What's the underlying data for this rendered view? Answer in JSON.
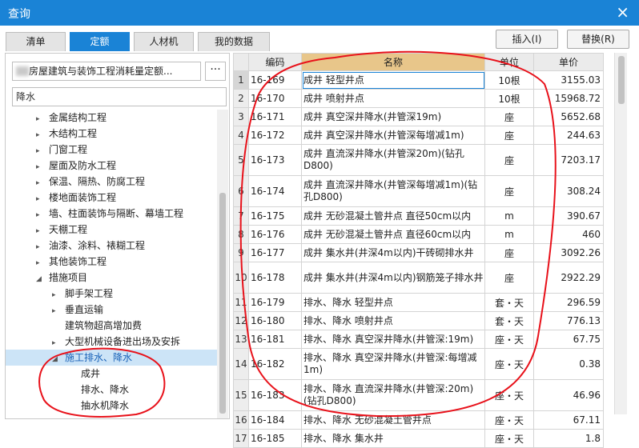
{
  "window": {
    "title": "查询",
    "close_icon": "×"
  },
  "tabs": [
    {
      "label": "清单",
      "active": false
    },
    {
      "label": "定额",
      "active": true
    },
    {
      "label": "人材机",
      "active": false
    },
    {
      "label": "我的数据",
      "active": false
    }
  ],
  "actions": {
    "insert_label": "插入(I)",
    "replace_label": "替换(R)"
  },
  "library": {
    "name": "房屋建筑与装饰工程消耗量定额...",
    "more_label": "···"
  },
  "search": {
    "value": "降水"
  },
  "tree": [
    {
      "label": "金属结构工程",
      "level": 0,
      "expander": "▸"
    },
    {
      "label": "木结构工程",
      "level": 0,
      "expander": "▸"
    },
    {
      "label": "门窗工程",
      "level": 0,
      "expander": "▸"
    },
    {
      "label": "屋面及防水工程",
      "level": 0,
      "expander": "▸"
    },
    {
      "label": "保温、隔热、防腐工程",
      "level": 0,
      "expander": "▸"
    },
    {
      "label": "楼地面装饰工程",
      "level": 0,
      "expander": "▸"
    },
    {
      "label": "墙、柱面装饰与隔断、幕墙工程",
      "level": 0,
      "expander": "▸"
    },
    {
      "label": "天棚工程",
      "level": 0,
      "expander": "▸"
    },
    {
      "label": "油漆、涂料、裱糊工程",
      "level": 0,
      "expander": "▸"
    },
    {
      "label": "其他装饰工程",
      "level": 0,
      "expander": "▸"
    },
    {
      "label": "措施项目",
      "level": 0,
      "expander": "◢"
    },
    {
      "label": "脚手架工程",
      "level": 1,
      "expander": "▸"
    },
    {
      "label": "垂直运输",
      "level": 1,
      "expander": "▸"
    },
    {
      "label": "建筑物超高增加费",
      "level": 1,
      "expander": ""
    },
    {
      "label": "大型机械设备进出场及安拆",
      "level": 1,
      "expander": "▸"
    },
    {
      "label": "施工排水、降水",
      "level": 1,
      "expander": "◢",
      "selected": true
    },
    {
      "label": "成井",
      "level": 2,
      "expander": ""
    },
    {
      "label": "排水、降水",
      "level": 2,
      "expander": ""
    },
    {
      "label": "抽水机降水",
      "level": 2,
      "expander": ""
    }
  ],
  "table": {
    "headers": {
      "code": "编码",
      "name": "名称",
      "unit": "单位",
      "price": "单价"
    },
    "rows": [
      {
        "n": "1",
        "code": "16-169",
        "name": "成井 轻型井点",
        "unit": "10根",
        "price": "3155.03"
      },
      {
        "n": "2",
        "code": "16-170",
        "name": "成井 喷射井点",
        "unit": "10根",
        "price": "15968.72"
      },
      {
        "n": "3",
        "code": "16-171",
        "name": "成井 真空深井降水(井管深19m)",
        "unit": "座",
        "price": "5652.68"
      },
      {
        "n": "4",
        "code": "16-172",
        "name": "成井 真空深井降水(井管深每增减1m)",
        "unit": "座",
        "price": "244.63"
      },
      {
        "n": "5",
        "code": "16-173",
        "name": "成井 直流深井降水(井管深20m)(钻孔D800)",
        "unit": "座",
        "price": "7203.17"
      },
      {
        "n": "6",
        "code": "16-174",
        "name": "成井 直流深井降水(井管深每增减1m)(钻孔D800)",
        "unit": "座",
        "price": "308.24"
      },
      {
        "n": "7",
        "code": "16-175",
        "name": "成井 无砂混凝土管井点 直径50cm以内",
        "unit": "m",
        "price": "390.67"
      },
      {
        "n": "8",
        "code": "16-176",
        "name": "成井 无砂混凝土管井点 直径60cm以内",
        "unit": "m",
        "price": "460"
      },
      {
        "n": "9",
        "code": "16-177",
        "name": "成井 集水井(井深4m以内)干砖砌排水井",
        "unit": "座",
        "price": "3092.26"
      },
      {
        "n": "10",
        "code": "16-178",
        "name": "成井 集水井(井深4m以内)钢筋笼子排水井",
        "unit": "座",
        "price": "2922.29"
      },
      {
        "n": "11",
        "code": "16-179",
        "name": "排水、降水 轻型井点",
        "unit": "套・天",
        "price": "296.59"
      },
      {
        "n": "12",
        "code": "16-180",
        "name": "排水、降水 喷射井点",
        "unit": "套・天",
        "price": "776.13"
      },
      {
        "n": "13",
        "code": "16-181",
        "name": "排水、降水 真空深井降水(井管深:19m)",
        "unit": "座・天",
        "price": "67.75"
      },
      {
        "n": "14",
        "code": "16-182",
        "name": "排水、降水 真空深井降水(井管深:每增减1m)",
        "unit": "座・天",
        "price": "0.38"
      },
      {
        "n": "15",
        "code": "16-183",
        "name": "排水、降水 直流深井降水(井管深:20m)(钻孔D800)",
        "unit": "座・天",
        "price": "46.96"
      },
      {
        "n": "16",
        "code": "16-184",
        "name": "排水、降水 无砂混凝土管井点",
        "unit": "座・天",
        "price": "67.11"
      },
      {
        "n": "17",
        "code": "16-185",
        "name": "排水、降水 集水井",
        "unit": "座・天",
        "price": "1.8"
      }
    ]
  },
  "colors": {
    "accent": "#1a83d6",
    "annotation": "#e8111a",
    "name_header": "#e8c68a"
  }
}
